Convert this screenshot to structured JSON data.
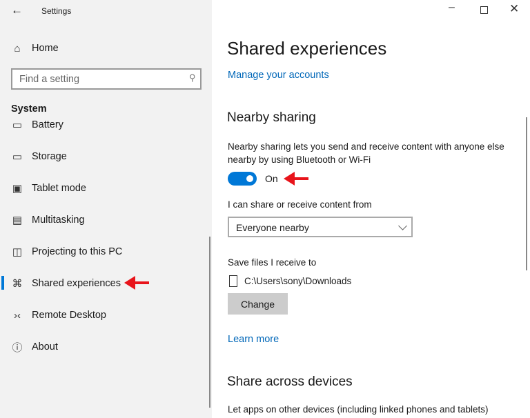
{
  "window": {
    "title": "Settings",
    "back_icon": "arrow-left-icon",
    "controls": [
      "minimize",
      "maximize",
      "close"
    ]
  },
  "sidebar": {
    "home": "Home",
    "search_placeholder": "Find a setting",
    "section": "System",
    "items": [
      {
        "label": "Battery",
        "icon": "battery-icon"
      },
      {
        "label": "Storage",
        "icon": "storage-icon"
      },
      {
        "label": "Tablet mode",
        "icon": "tablet-mode-icon"
      },
      {
        "label": "Multitasking",
        "icon": "multitasking-icon"
      },
      {
        "label": "Projecting to this PC",
        "icon": "projecting-icon"
      },
      {
        "label": "Shared experiences",
        "icon": "shared-icon",
        "selected": true
      },
      {
        "label": "Remote Desktop",
        "icon": "remote-desktop-icon"
      },
      {
        "label": "About",
        "icon": "info-icon"
      }
    ]
  },
  "main": {
    "title": "Shared experiences",
    "manage_link": "Manage your accounts",
    "nearby": {
      "heading": "Nearby sharing",
      "description": "Nearby sharing lets you send and receive content with anyone else nearby by using Bluetooth or Wi-Fi",
      "toggle_state": "On",
      "share_from_label": "I can share or receive content from",
      "share_from_value": "Everyone nearby",
      "save_label": "Save files I receive to",
      "save_path": "C:\\Users\\sony\\Downloads",
      "change_button": "Change",
      "learn_more": "Learn more"
    },
    "across": {
      "heading": "Share across devices",
      "description": "Let apps on other devices (including linked phones and tablets)"
    }
  },
  "colors": {
    "accent": "#0078d7",
    "link": "#0067b8",
    "annotation": "#e8141b"
  }
}
